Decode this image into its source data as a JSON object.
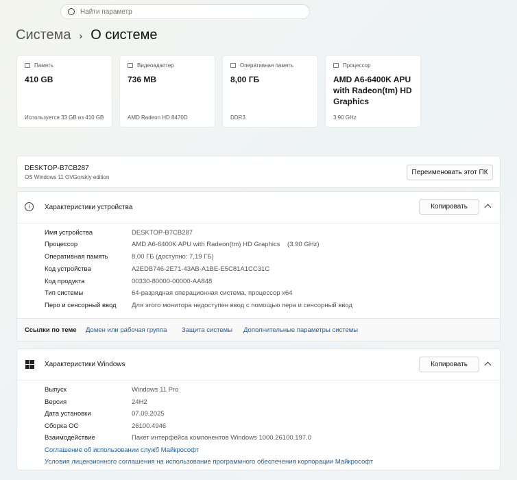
{
  "search": {
    "placeholder": "Найти параметр"
  },
  "breadcrumb": {
    "parent": "Система",
    "separator": "›",
    "current": "О системе"
  },
  "cards": [
    {
      "label": "Память",
      "value": "410 GB",
      "sub": "Используется 33 GB из 410 GB"
    },
    {
      "label": "Видеоадаптер",
      "value": "736 MB",
      "sub": "AMD Radeon HD 8470D"
    },
    {
      "label": "Оперативная память",
      "value": "8,00 ГБ",
      "sub": "DDR3"
    },
    {
      "label": "Процессор",
      "value": "AMD A6-6400K APU with Radeon(tm) HD Graphics",
      "sub": "3.90 GHz"
    }
  ],
  "pc": {
    "name": "DESKTOP-B7CB287",
    "edition": "OS Windows 11 OVGorskiy edition",
    "rename": "Переименовать этот ПК"
  },
  "device": {
    "title": "Характеристики устройства",
    "copy": "Копировать",
    "rows": [
      {
        "k": "Имя устройства",
        "v": "DESKTOP-B7CB287"
      },
      {
        "k": "Процессор",
        "v": "AMD A6-6400K APU with Radeon(tm) HD Graphics    (3.90 GHz)"
      },
      {
        "k": "Оперативная память",
        "v": "8,00 ГБ (доступно: 7,19 ГБ)"
      },
      {
        "k": "Код устройства",
        "v": "A2EDB746-2E71-43AB-A1BE-E5C81A1CC31C"
      },
      {
        "k": "Код продукта",
        "v": "00330-80000-00000-AA848"
      },
      {
        "k": "Тип системы",
        "v": "64-разрядная операционная система, процессор x64"
      },
      {
        "k": "Перо и сенсорный ввод",
        "v": "Для этого монитора недоступен ввод с помощью пера и сенсорный ввод"
      }
    ]
  },
  "related": {
    "label": "Ссылки по теме",
    "links": [
      "Домен или рабочая группа",
      "Защита системы",
      "Дополнительные параметры системы"
    ]
  },
  "windows": {
    "title": "Характеристики Windows",
    "copy": "Копировать",
    "rows": [
      {
        "k": "Выпуск",
        "v": "Windows 11 Pro"
      },
      {
        "k": "Версия",
        "v": "24H2"
      },
      {
        "k": "Дата установки",
        "v": "07.09.2025"
      },
      {
        "k": "Сборка ОС",
        "v": "26100.4946"
      },
      {
        "k": "Взаимодействие",
        "v": "Пакет интерфейса компонентов Windows 1000.26100.197.0"
      }
    ],
    "links": [
      "Соглашение об использовании служб Майкрософт",
      "Условия лицензионного соглашения на использование программного обеспечения корпорации Майкрософт"
    ]
  }
}
